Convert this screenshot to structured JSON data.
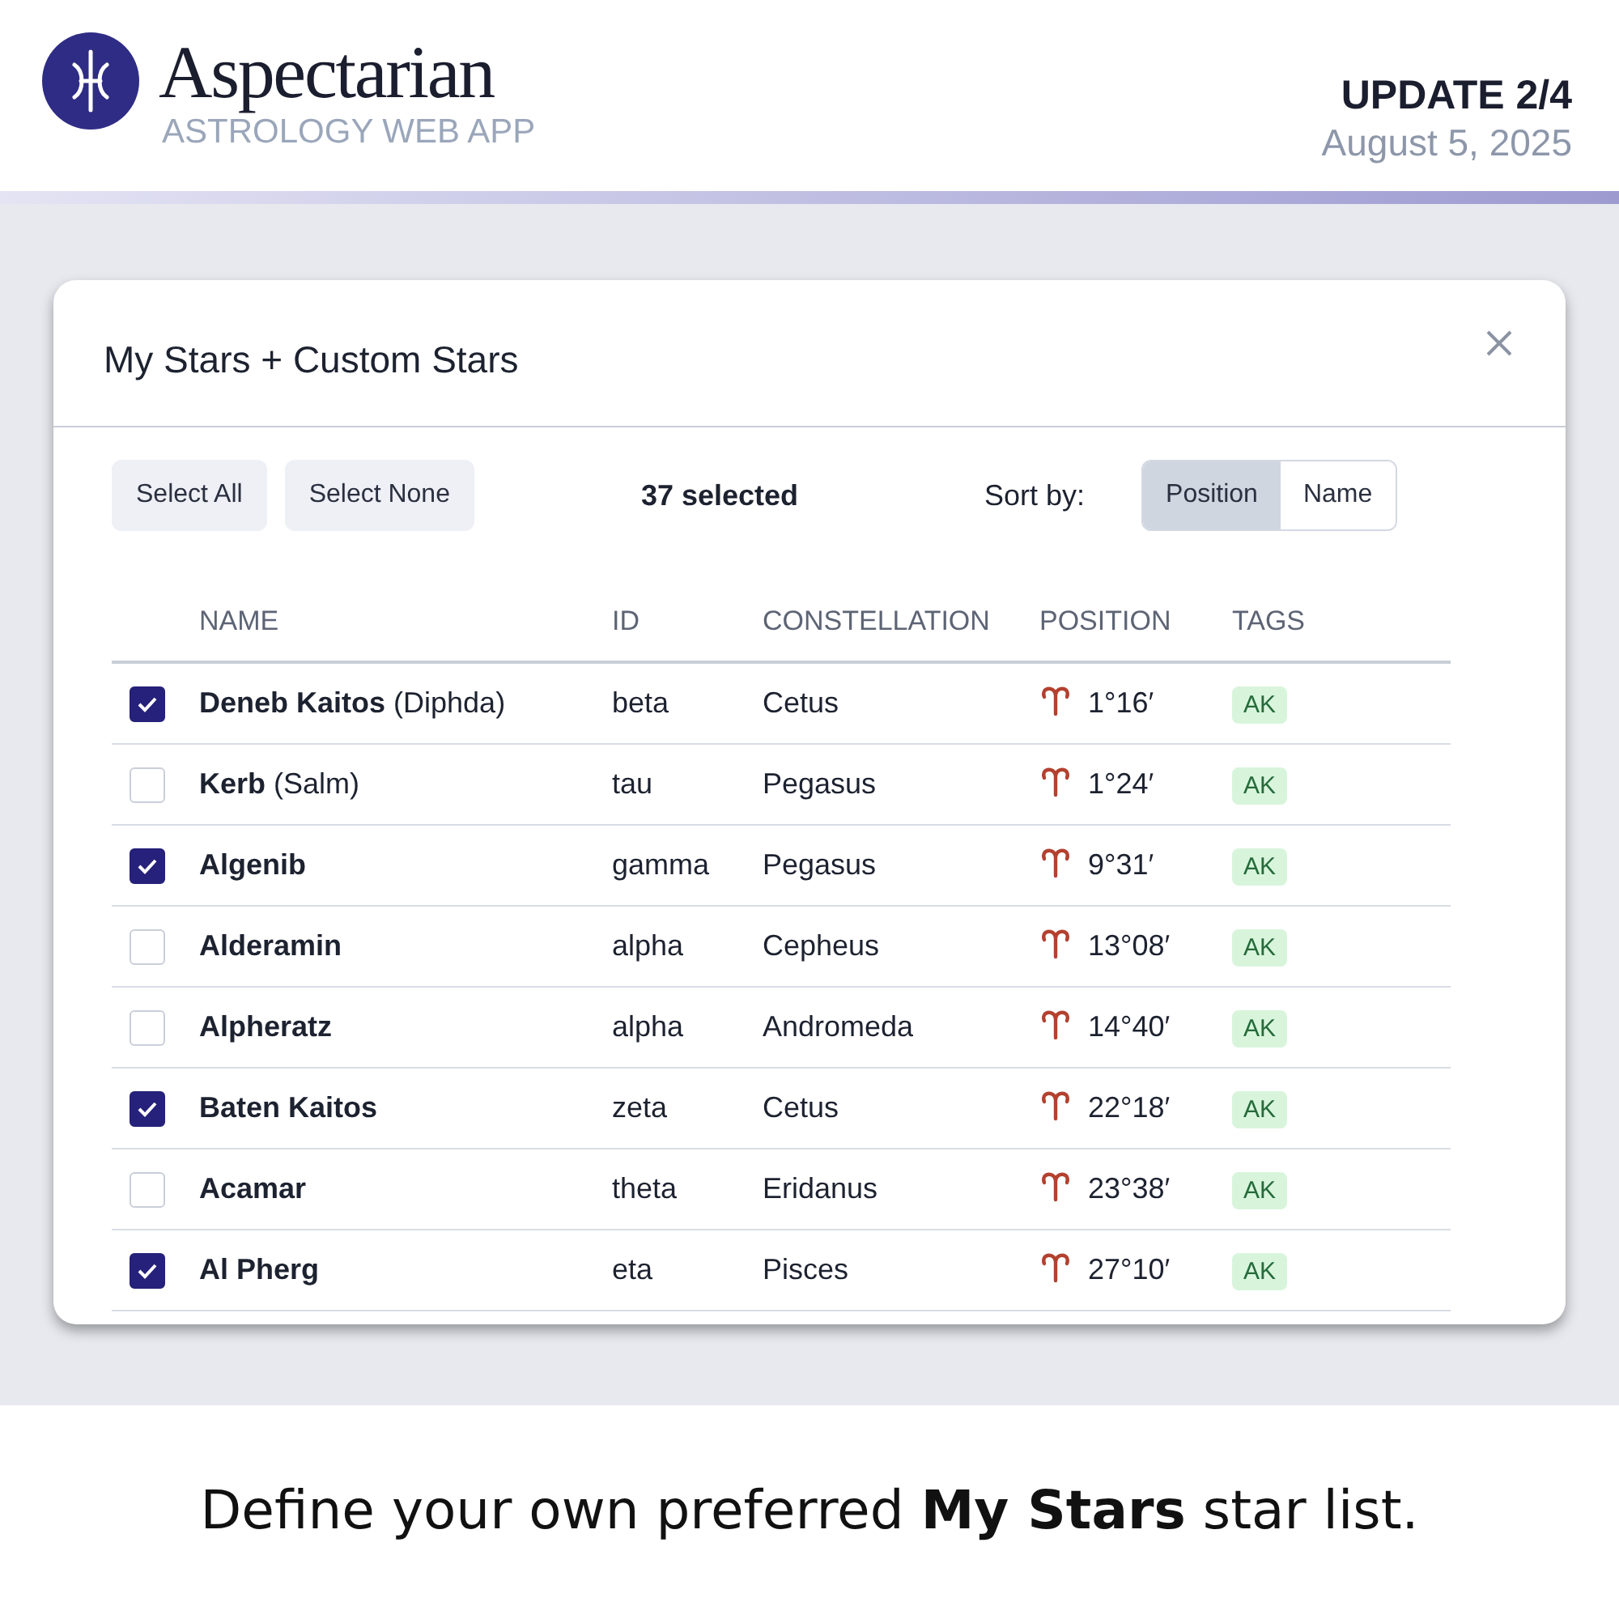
{
  "header": {
    "brand": "Aspectarian",
    "tagline": "ASTROLOGY WEB APP",
    "update": "UPDATE 2/4",
    "date": "August 5, 2025"
  },
  "dialog": {
    "title": "My Stars + Custom Stars",
    "toolbar": {
      "buttons": [
        "Select All",
        "Select None"
      ],
      "count": "37 selected",
      "sort_label": "Sort by:",
      "sort_options": [
        {
          "label": "Position",
          "selected": true
        },
        {
          "label": "Name",
          "selected": false
        }
      ]
    },
    "table": {
      "columns": [
        "NAME",
        "ID",
        "CONSTELLATION",
        "POSITION",
        "TAGS"
      ],
      "rows": [
        {
          "checked": true,
          "name": "Deneb Kaitos",
          "alias": "(Diphda)",
          "id": "beta",
          "constellation": "Cetus",
          "position": "1°16′",
          "tag": "AK"
        },
        {
          "checked": false,
          "name": "Kerb",
          "alias": "(Salm)",
          "id": "tau",
          "constellation": "Pegasus",
          "position": "1°24′",
          "tag": "AK"
        },
        {
          "checked": true,
          "name": "Algenib",
          "id": "gamma",
          "constellation": "Pegasus",
          "position": "9°31′",
          "tag": "AK"
        },
        {
          "checked": false,
          "name": "Alderamin",
          "id": "alpha",
          "constellation": "Cepheus",
          "position": "13°08′",
          "tag": "AK"
        },
        {
          "checked": false,
          "name": "Alpheratz",
          "id": "alpha",
          "constellation": "Andromeda",
          "position": "14°40′",
          "tag": "AK"
        },
        {
          "checked": true,
          "name": "Baten Kaitos",
          "id": "zeta",
          "constellation": "Cetus",
          "position": "22°18′",
          "tag": "AK"
        },
        {
          "checked": false,
          "name": "Acamar",
          "id": "theta",
          "constellation": "Eridanus",
          "position": "23°38′",
          "tag": "AK"
        },
        {
          "checked": true,
          "name": "Al Pherg",
          "id": "eta",
          "constellation": "Pisces",
          "position": "27°10′",
          "tag": "AK"
        }
      ]
    }
  },
  "caption": "Define your own preferred **My Stars** star list."
}
